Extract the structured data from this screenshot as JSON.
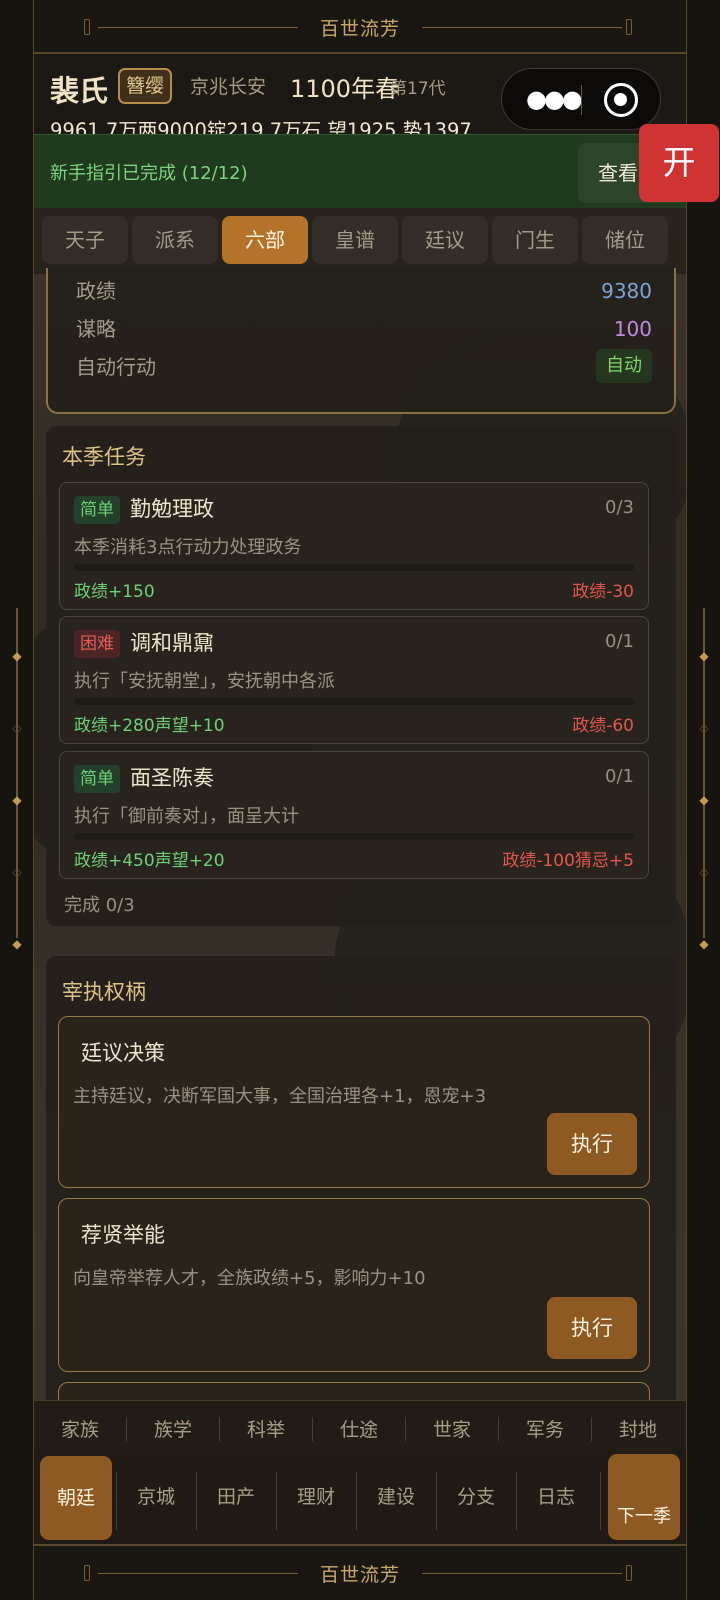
{
  "banner": {
    "title": "百世流芳"
  },
  "header": {
    "clan": "裴氏",
    "rank": "簪缨",
    "location": "京兆长安",
    "season": "1100年春",
    "generation": "第17代",
    "resources": "9961.7万两9000锭219.7万石  望1925 势1397"
  },
  "capsule": {
    "more_icon": "more-dots-icon",
    "close_icon": "target-circle-icon"
  },
  "guide": {
    "text": "新手指引已完成 (12/12)",
    "button": "查看"
  },
  "open_button": "开",
  "tabs": [
    {
      "label": "天子"
    },
    {
      "label": "派系"
    },
    {
      "label": "六部",
      "active": true
    },
    {
      "label": "皇谱"
    },
    {
      "label": "廷议"
    },
    {
      "label": "门生"
    },
    {
      "label": "储位"
    }
  ],
  "stats": [
    {
      "label": "政绩",
      "value": "9380",
      "color": "#7aa5d8"
    },
    {
      "label": "谋略",
      "value": "100",
      "color": "#c08ae0"
    },
    {
      "label": "自动行动",
      "value": "自动",
      "color": "#82d46a"
    }
  ],
  "tasks": {
    "title": "本季任务",
    "items": [
      {
        "difficulty": "简单",
        "name": "勤勉理政",
        "progress": "0/3",
        "progress_fraction": 0,
        "desc": "本季消耗3点行动力处理政务",
        "reward": "政绩+150",
        "penalty": "政绩-30"
      },
      {
        "difficulty": "困难",
        "name": "调和鼎鼐",
        "progress": "0/1",
        "progress_fraction": 0,
        "desc": "执行「安抚朝堂」，安抚朝中各派",
        "reward": "政绩+280声望+10",
        "penalty": "政绩-60"
      },
      {
        "difficulty": "简单",
        "name": "面圣陈奏",
        "progress": "0/1",
        "progress_fraction": 0,
        "desc": "执行「御前奏对」，面呈大计",
        "reward": "政绩+450声望+20",
        "penalty": "政绩-100猜忌+5"
      }
    ],
    "complete": "完成 0/3"
  },
  "powers": {
    "title": "宰执权柄",
    "items": [
      {
        "name": "廷议决策",
        "desc": "主持廷议，决断军国大事，全国治理各+1，恩宠+3",
        "button": "执行"
      },
      {
        "name": "荐贤举能",
        "desc": "向皇帝举荐人才，全族政绩+5，影响力+10",
        "button": "执行"
      }
    ]
  },
  "nav_top": [
    {
      "label": "家族"
    },
    {
      "label": "族学"
    },
    {
      "label": "科举"
    },
    {
      "label": "仕途"
    },
    {
      "label": "世家"
    },
    {
      "label": "军务"
    },
    {
      "label": "封地"
    }
  ],
  "nav_bottom": [
    {
      "label": "朝廷",
      "active": true
    },
    {
      "label": "京城"
    },
    {
      "label": "田产"
    },
    {
      "label": "理财"
    },
    {
      "label": "建设"
    },
    {
      "label": "分支"
    },
    {
      "label": "日志"
    }
  ],
  "next_season": "下一季"
}
